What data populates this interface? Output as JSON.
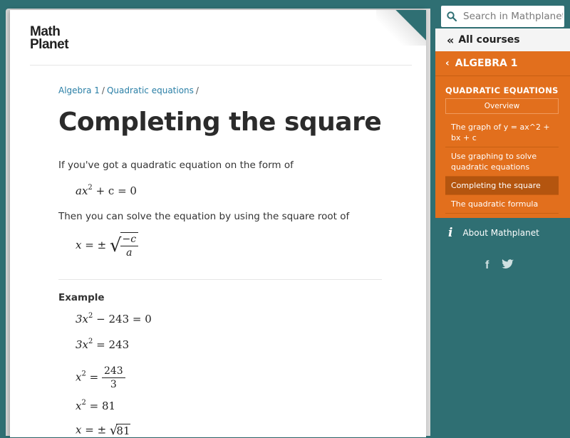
{
  "logo": {
    "line1": "Math",
    "line2": "Planet"
  },
  "breadcrumb": {
    "items": [
      "Algebra 1",
      "Quadratic equations"
    ],
    "sep": "/"
  },
  "page": {
    "title": "Completing the square",
    "p1": "If you've got a quadratic equation on the form of",
    "p2": "Then you can solve the equation by using the square root of",
    "example_label": "Example"
  },
  "math": {
    "eq_form": {
      "a": "ax",
      "exp": "2",
      "rest": "+ c = 0"
    },
    "root_formula": {
      "lhs": "x = ±",
      "num": "−c",
      "den": "a"
    },
    "ex1": {
      "lhs": "3x",
      "exp": "2",
      "rest": "− 243 = 0"
    },
    "ex2": {
      "lhs": "3x",
      "exp": "2",
      "rest": "= 243"
    },
    "ex3": {
      "lhs": "x",
      "exp": "2",
      "eq": "=",
      "num": "243",
      "den": "3"
    },
    "ex4": {
      "lhs": "x",
      "exp": "2",
      "rest": "= 81"
    },
    "ex5": {
      "lhs": "x = ±",
      "radicand": "81"
    }
  },
  "sidebar": {
    "search_placeholder": "Search in Mathplanet",
    "all_courses": "All courses",
    "course": "ALGEBRA 1",
    "section_title": "QUADRATIC EQUATIONS",
    "overview": "Overview",
    "items": [
      {
        "label": "The graph of y = ax^2 + bx + c"
      },
      {
        "label": "Use graphing to solve quadratic equations"
      },
      {
        "label": "Completing the square"
      },
      {
        "label": "The quadratic formula"
      }
    ],
    "about": "About Mathplanet",
    "social": {
      "facebook": "f",
      "twitter": "twitter"
    }
  },
  "colors": {
    "teal": "#2f6f73",
    "orange": "#e26f1d",
    "active": "#b4550f",
    "link": "#2a7fa6"
  }
}
